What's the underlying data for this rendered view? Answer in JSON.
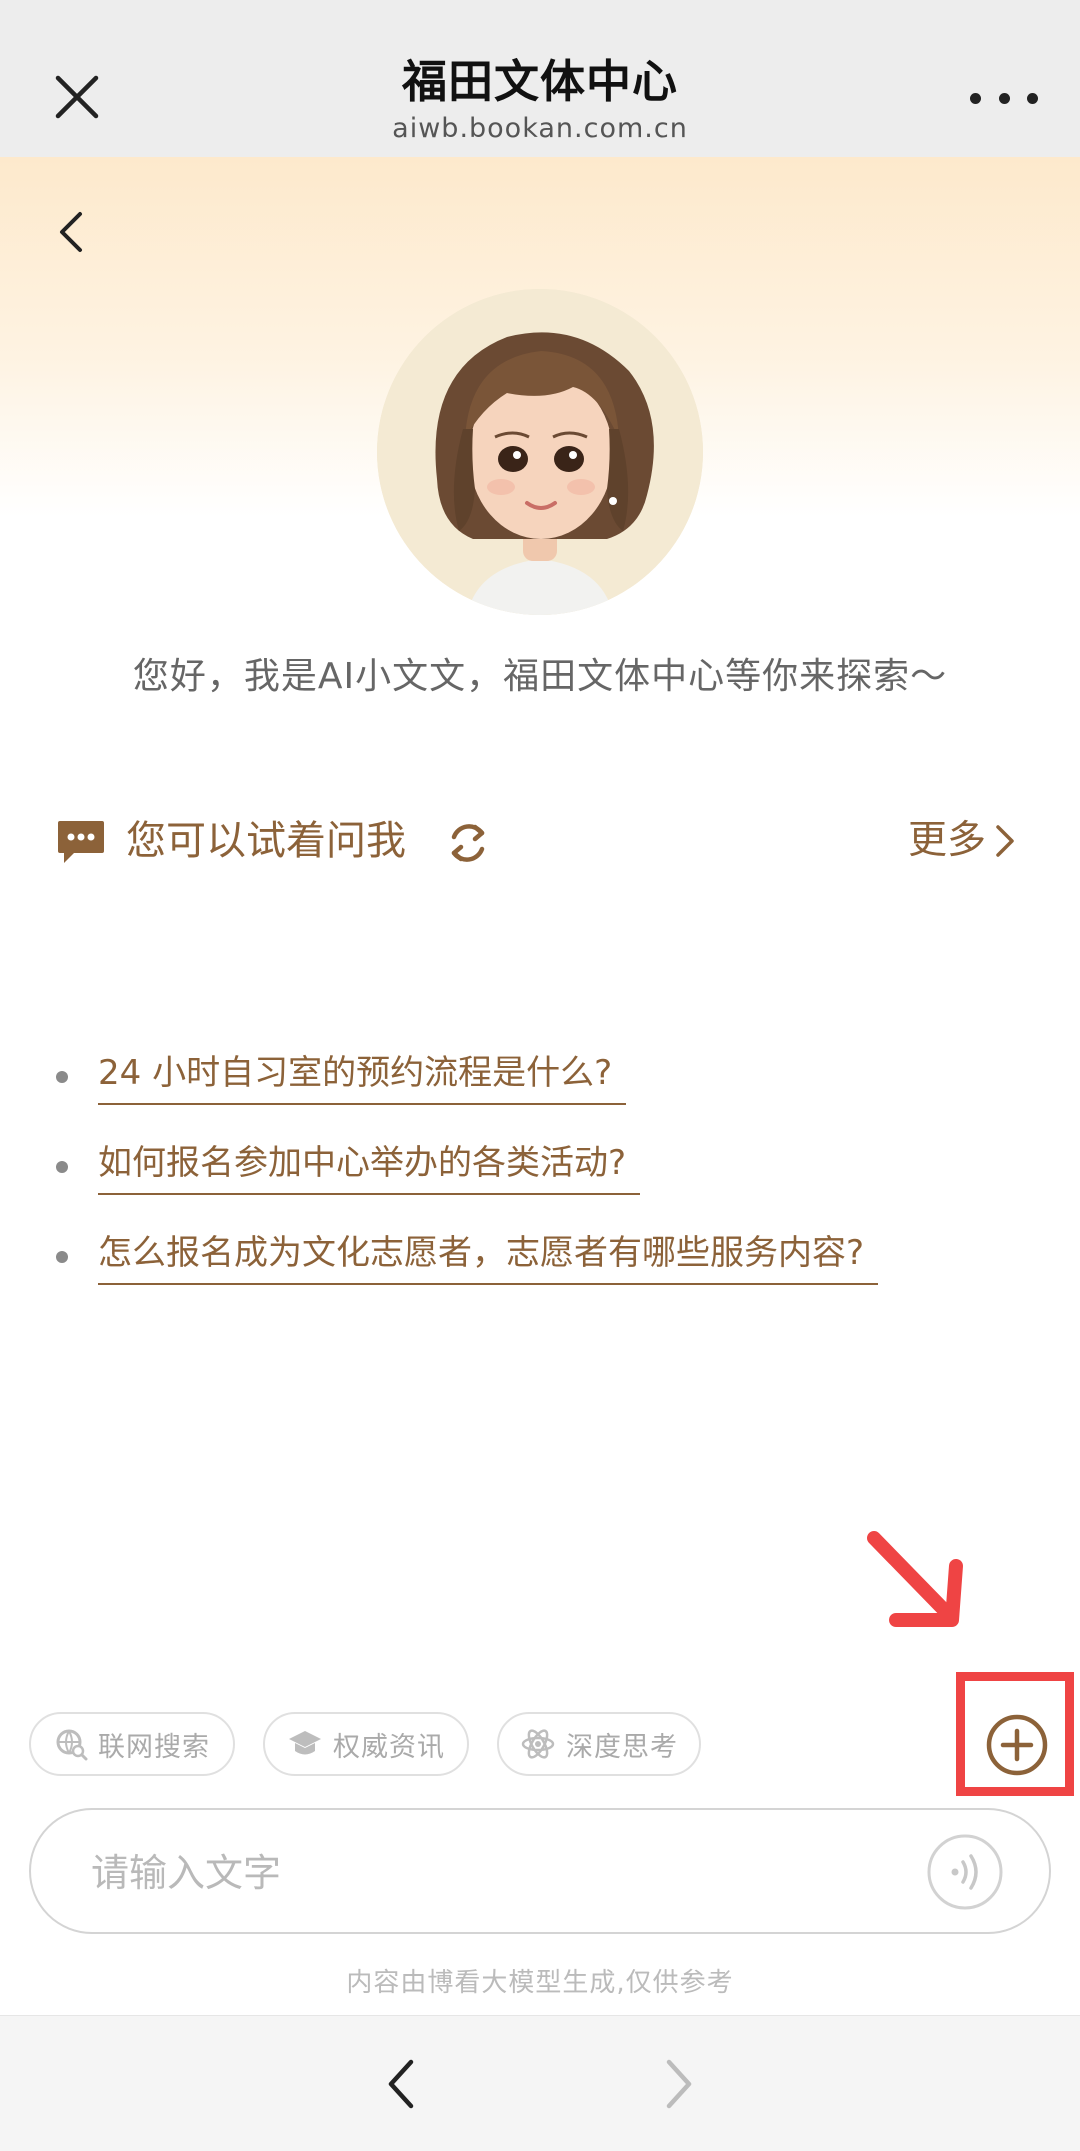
{
  "header": {
    "title": "福田文体中心",
    "url": "aiwb.bookan.com.cn",
    "close_icon": "close-icon",
    "more_icon": "more-dots-icon"
  },
  "main": {
    "greeting": "您好，我是AI小文文，福田文体中心等你来探索～",
    "suggestions": {
      "title": "您可以试着问我",
      "more_label": "更多",
      "items": [
        "24 小时自习室的预约流程是什么?",
        "如何报名参加中心举办的各类活动?",
        "怎么报名成为文化志愿者，志愿者有哪些服务内容?"
      ]
    }
  },
  "chips": [
    {
      "label": "联网搜索",
      "icon": "globe-search-icon"
    },
    {
      "label": "权威资讯",
      "icon": "graduation-cap-icon"
    },
    {
      "label": "深度思考",
      "icon": "atom-icon"
    }
  ],
  "input": {
    "placeholder": "请输入文字",
    "value": ""
  },
  "disclaimer": "内容由博看大模型生成,仅供参考",
  "colors": {
    "accent": "#8c6239",
    "annotation": "#ef4444",
    "topbar_bg": "#ededed"
  }
}
